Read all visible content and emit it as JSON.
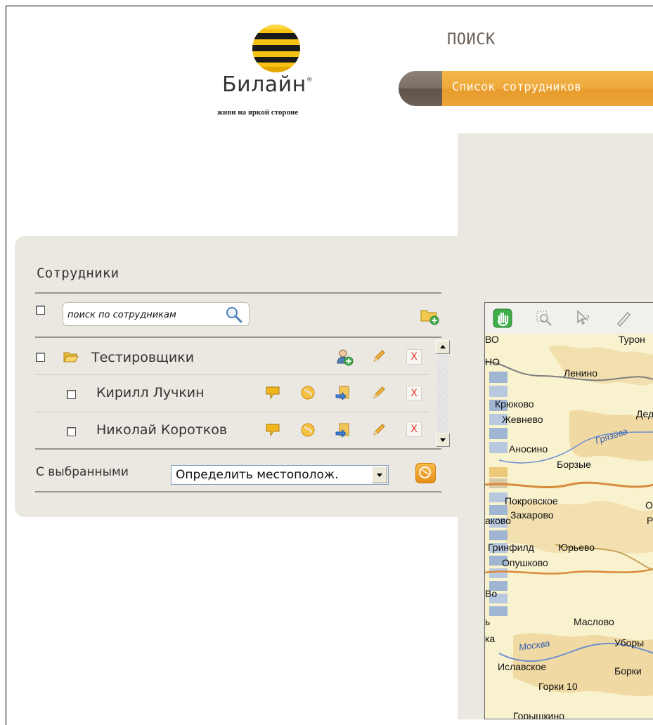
{
  "brand": {
    "name": "Билайн",
    "registered_mark": "®",
    "tagline": "живи на яркой стороне"
  },
  "header": {
    "title": "ПОИСК",
    "tabs": [
      {
        "label": "Список сотрудников",
        "active": true
      }
    ]
  },
  "employees_panel": {
    "title": "Сотрудники",
    "search": {
      "placeholder": "поиск по сотрудникам",
      "value": ""
    },
    "groups": [
      {
        "name": "Тестировщики",
        "checked": false,
        "members": [
          {
            "name": "Кирилл Лучкин",
            "checked": false
          },
          {
            "name": "Николай Коротков",
            "checked": false
          }
        ]
      }
    ],
    "bulk": {
      "label": "С выбранными",
      "selected_action": "Определить местополож."
    }
  },
  "map": {
    "tools": [
      "pan-hand-icon",
      "zoom-area-icon",
      "identify-icon",
      "ruler-icon"
    ],
    "places": [
      "Турон",
      "Ленино",
      "Крюково",
      "Дед",
      "Жевнево",
      "Аносино",
      "Борзые",
      "Покровское",
      "Захарово",
      "Гринфилд",
      "Юрьево",
      "Опушково",
      "Маслово",
      "Уборы",
      "Иславское",
      "Борки",
      "Горки 10",
      "Горышкино"
    ],
    "partial_labels": [
      "ВО",
      "НО",
      "О",
      "Р",
      "аково",
      "Во",
      "ь",
      "ка"
    ],
    "rivers": [
      "Грязёва",
      "Москва"
    ]
  },
  "colors": {
    "accent_orange": "#eea93a",
    "tab_dark": "#7a6f66",
    "panel_gray": "#ebe8e1",
    "map_land": "#f7f0c8",
    "delete_red": "#e23a2a"
  }
}
